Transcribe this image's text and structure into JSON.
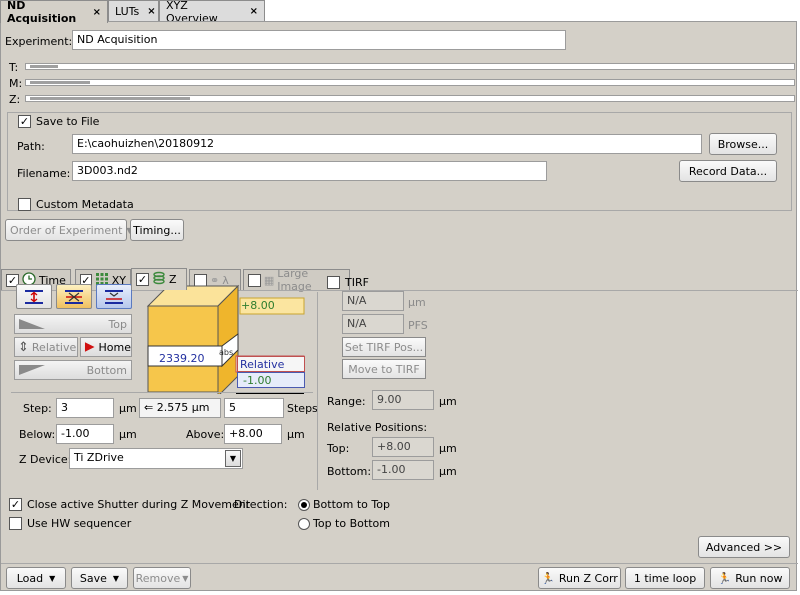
{
  "tabs": [
    {
      "label": "ND Acquisition",
      "close": "×"
    },
    {
      "label": "LUTs",
      "close": "×"
    },
    {
      "label": "XYZ Overview",
      "close": "×"
    }
  ],
  "experiment": {
    "label": "Experiment:",
    "value": "ND Acquisition"
  },
  "loops": {
    "t": "T:",
    "m": "M:",
    "z": "Z:"
  },
  "save": {
    "checkbox_label": "Save to File",
    "checked": "✓",
    "path_label": "Path:",
    "path_value": "E:\\caohuizhen\\20180912",
    "browse": "Browse...",
    "filename_label": "Filename:",
    "filename_value": "3D003.nd2",
    "record": "Record Data..."
  },
  "custom_metadata": "Custom Metadata",
  "order": {
    "label": "Order of Experiment",
    "timing": "Timing..."
  },
  "subtabs": {
    "time": "Time",
    "xy": "XY",
    "z": "Z",
    "lambda": "λ",
    "large": "Large Image"
  },
  "z_panel": {
    "top_btn": "Top",
    "relative_btn": "Relative",
    "home_btn": "Home",
    "bottom_btn": "Bottom",
    "diagram": {
      "top": "+8.00",
      "relative": "Relative",
      "bottom": "-1.00",
      "pos": "2339.20",
      "abs": "abs"
    },
    "step_label": "Step:",
    "step_value": "3",
    "step_unit": "µm",
    "step_mid": "2.575 µm",
    "steps_value": "5",
    "steps_label": "Steps",
    "below_label": "Below:",
    "below_value": "-1.00",
    "below_unit": "µm",
    "above_label": "Above:",
    "above_value": "+8.00",
    "above_unit": "µm",
    "zdevice_label": "Z Device:",
    "zdevice_value": "Ti ZDrive",
    "range_label": "Range:",
    "range_value": "9.00",
    "range_unit": "µm",
    "rel_pos_label": "Relative Positions:",
    "rel_top_label": "Top:",
    "rel_top_value": "+8.00",
    "rel_top_unit": "µm",
    "rel_bottom_label": "Bottom:",
    "rel_bottom_value": "-1.00",
    "rel_bottom_unit": "µm"
  },
  "tirf": {
    "label": "TIRF",
    "field1": "N/A",
    "unit1": "µm",
    "field2": "N/A",
    "unit2": "PFS",
    "set_btn": "Set TIRF Pos...",
    "move_btn": "Move to TIRF"
  },
  "options": {
    "close_shutter": "Close active Shutter during Z Movement",
    "hw_seq": "Use HW sequencer",
    "direction_label": "Direction:",
    "bottom_to_top": "Bottom to Top",
    "top_to_bottom": "Top to Bottom"
  },
  "advanced": "Advanced >>",
  "footer": {
    "load": "Load",
    "save": "Save",
    "remove": "Remove",
    "run_z_corr": "Run Z Corr",
    "loop": "1 time loop",
    "run_now": "Run now"
  },
  "colors": {
    "panel": "#d4d0c8",
    "top_green": "#2f7d2f",
    "relative_blue": "#2330a0",
    "cube_yellow": "#f6c64b"
  }
}
